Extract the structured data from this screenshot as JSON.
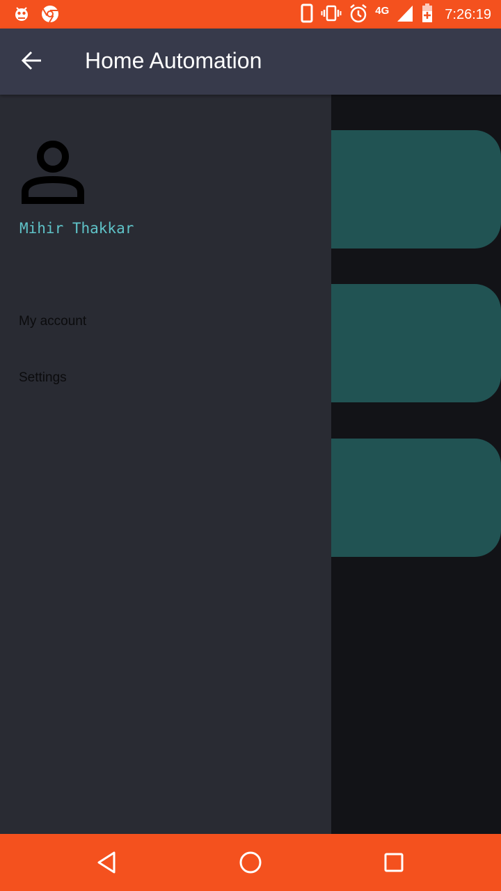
{
  "status_bar": {
    "network": "4G",
    "time": "7:26:19",
    "icons": [
      "bug-icon",
      "chrome-icon",
      "phone-icon",
      "vibrate-icon",
      "alarm-icon",
      "signal-icon",
      "battery-charging-icon"
    ]
  },
  "app_bar": {
    "title": "Home Automation",
    "back_icon": "arrow-back-icon"
  },
  "drawer": {
    "user_name": "Mihir Thakkar",
    "avatar_icon": "person-icon",
    "items": [
      {
        "label": "My account"
      },
      {
        "label": "Settings"
      }
    ]
  },
  "content": {
    "cards": 3
  },
  "nav_bar": {
    "icons": [
      "nav-back-icon",
      "nav-home-icon",
      "nav-recent-icon"
    ]
  },
  "colors": {
    "status_bar": "#f4511e",
    "app_bar": "#373a4b",
    "drawer": "#292b33",
    "background": "#121317",
    "card": "#215353",
    "user_name": "#5fc3c8",
    "nav_bar": "#f4511e"
  }
}
